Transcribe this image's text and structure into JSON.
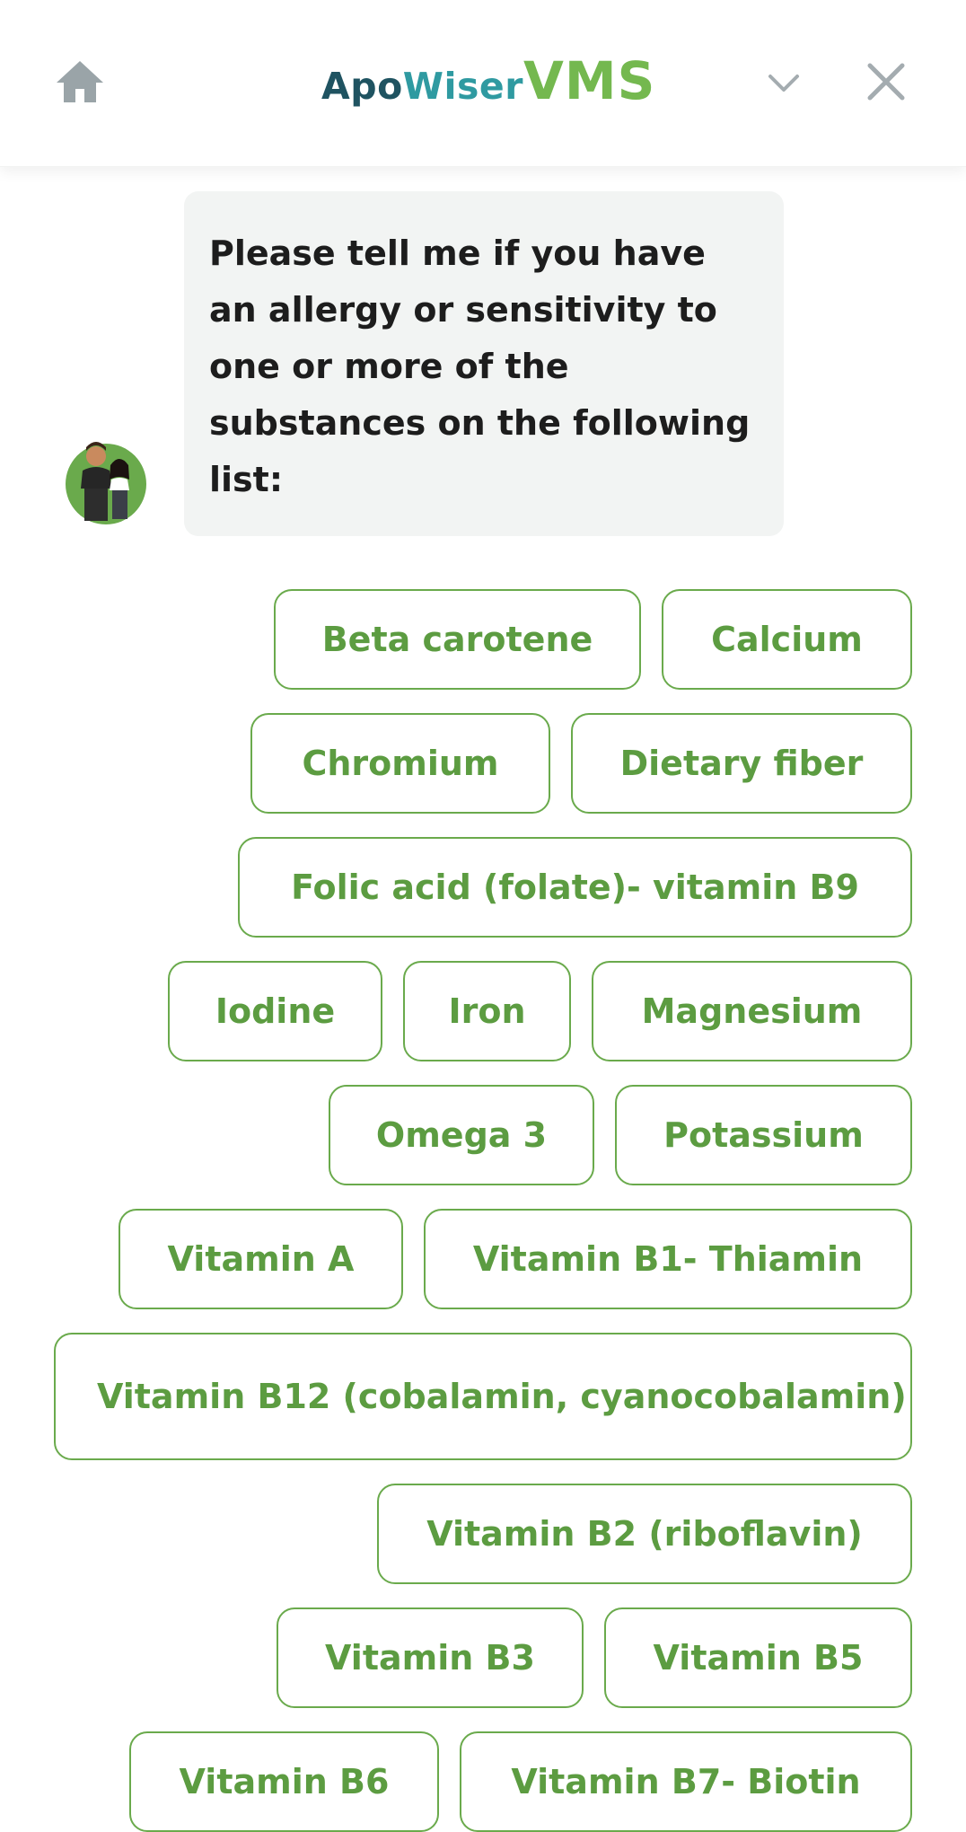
{
  "header": {
    "brand_apo": "Apo",
    "brand_wiser": "Wiser",
    "brand_vms": "VMS",
    "home_icon": "home-icon",
    "chevron_icon": "chevron-down-icon",
    "close_icon": "close-icon"
  },
  "colors": {
    "accent_green": "#6aaa4c",
    "chip_text": "#5c9c41",
    "bubble_bg": "#f2f4f3",
    "brand_dark": "#1f5361",
    "brand_teal": "#2f9aa1",
    "brand_green": "#74b84f"
  },
  "message": {
    "text": "Please tell me if you have an allergy or sensitivity to one or more of the substances on the following list:"
  },
  "options": [
    "Beta carotene",
    "Calcium",
    "Chromium",
    "Dietary fiber",
    "Folic acid (folate)- vitamin B9",
    "Iodine",
    "Iron",
    "Magnesium",
    "Omega 3",
    "Potassium",
    "Vitamin A",
    "Vitamin B1- Thiamin",
    "Vitamin B12 (cobalamin, cyanocobalamin)",
    "Vitamin B2 (riboflavin)",
    "Vitamin B3",
    "Vitamin B5",
    "Vitamin B6",
    "Vitamin B7- Biotin"
  ]
}
